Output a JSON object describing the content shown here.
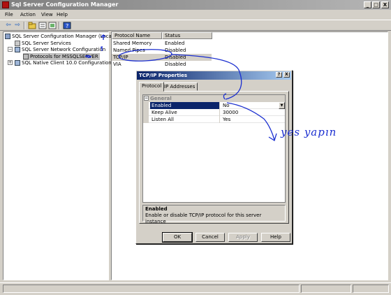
{
  "window": {
    "title": "Sql Server Configuration Manager",
    "min_label": "_",
    "max_label": "□",
    "close_label": "X"
  },
  "menu": {
    "items": [
      "File",
      "Action",
      "View",
      "Help"
    ]
  },
  "toolbar": {
    "icons": [
      "back-arrow-icon",
      "forward-arrow-icon",
      "up-folder-icon",
      "properties-icon",
      "export-icon",
      "help-icon"
    ]
  },
  "tree": {
    "items": [
      {
        "label": "SQL Server Configuration Manager (Local)",
        "icon": "server-config-icon"
      },
      {
        "label": "SQL Server Services",
        "icon": "services-icon"
      },
      {
        "label": "SQL Server Network Configuration",
        "icon": "network-config-icon",
        "expander": "−"
      },
      {
        "label": "Protocols for MSSQLSERVER",
        "icon": "protocols-icon",
        "selected": true
      },
      {
        "label": "SQL Native Client 10.0 Configuration",
        "icon": "client-config-icon",
        "expander": "+"
      }
    ]
  },
  "list": {
    "headers": [
      "Protocol Name",
      "Status"
    ],
    "rows": [
      {
        "name": "Shared Memory",
        "status": "Enabled"
      },
      {
        "name": "Named Pipes",
        "status": "Disabled"
      },
      {
        "name": "TCP/IP",
        "status": "Disabled",
        "selected": true
      },
      {
        "name": "VIA",
        "status": "Disabled"
      }
    ]
  },
  "dialog": {
    "title": "TCP/IP Properties",
    "help_label": "?",
    "close_label": "X",
    "tabs": [
      "Protocol",
      "IP Addresses"
    ],
    "active_tab": "Protocol",
    "category_expander": "−",
    "category": "General",
    "properties": [
      {
        "key": "Enabled",
        "value": "No",
        "selected": true
      },
      {
        "key": "Keep Alive",
        "value": "30000"
      },
      {
        "key": "Listen All",
        "value": "Yes"
      }
    ],
    "description_title": "Enabled",
    "description_text": "Enable or disable TCP/IP protocol for this server instance",
    "buttons": {
      "ok": "OK",
      "cancel": "Cancel",
      "apply": "Apply",
      "help": "Help"
    }
  },
  "annotation": {
    "text": "yes yapın",
    "color": "#1a2ed0"
  }
}
